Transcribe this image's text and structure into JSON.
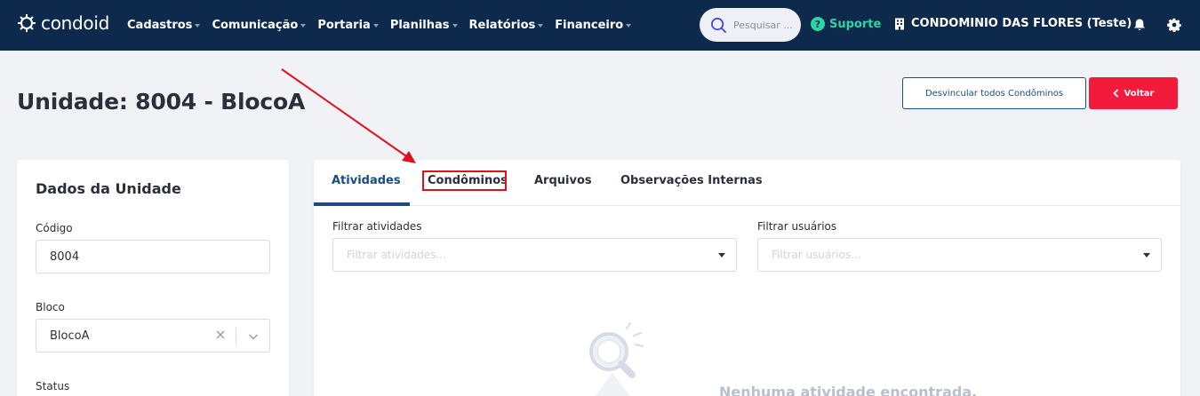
{
  "brand": {
    "name": "condoid"
  },
  "nav": {
    "items": [
      {
        "label": "Cadastros"
      },
      {
        "label": "Comunicação"
      },
      {
        "label": "Portaria"
      },
      {
        "label": "Planilhas"
      },
      {
        "label": "Relatórios"
      },
      {
        "label": "Financeiro"
      }
    ],
    "search_placeholder": "Pesquisar ...",
    "support_label": "Suporte",
    "condominium": "CONDOMINIO DAS FLORES (Teste)",
    "icons": [
      "search-icon",
      "help-icon",
      "building-icon",
      "bell-icon",
      "gear-icon"
    ]
  },
  "header": {
    "title": "Unidade: 8004 - BlocoA",
    "unlink_all_label": "Desvincular todos Condôminos",
    "back_label": "Voltar"
  },
  "unit_card": {
    "title": "Dados da Unidade",
    "code_label": "Código",
    "code_value": "8004",
    "block_label": "Bloco",
    "block_value": "BlocoA",
    "status_label": "Status"
  },
  "tabs": {
    "items": [
      {
        "label": "Atividades",
        "active": true
      },
      {
        "label": "Condôminos",
        "active": false,
        "highlighted": true
      },
      {
        "label": "Arquivos",
        "active": false
      },
      {
        "label": "Observações Internas",
        "active": false
      }
    ]
  },
  "filters": {
    "activities_label": "Filtrar atividades",
    "activities_placeholder": "Filtrar atividades...",
    "users_label": "Filtrar usuários",
    "users_placeholder": "Filtrar usuários..."
  },
  "empty_state": {
    "message": "Nenhuma atividade encontrada."
  },
  "colors": {
    "navbar": "#0d2a4c",
    "primary": "#1b4c84",
    "danger": "#f31b3c",
    "support": "#2fd4a4",
    "annotation": "#e01020"
  }
}
